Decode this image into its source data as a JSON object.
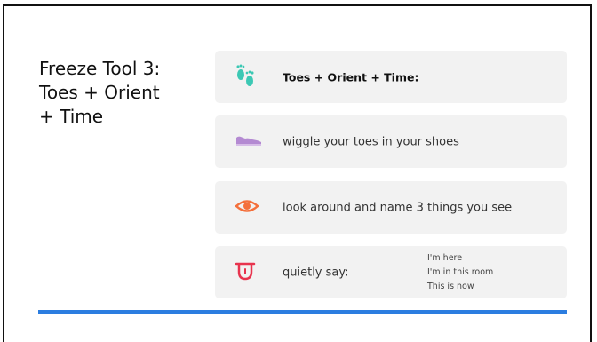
{
  "slide": {
    "title_lines": [
      "Freeze Tool 3:",
      "Toes + Orient",
      "+ Time"
    ],
    "cards": [
      {
        "icon": "footprints-icon",
        "text": "Toes + Orient + Time:",
        "color": "#3cc8b4"
      },
      {
        "icon": "shoe-icon",
        "text": "wiggle your toes in your shoes",
        "color": "#b48ad2"
      },
      {
        "icon": "eye-icon",
        "text": "look around and name 3 things you see",
        "color": "#f4703c"
      },
      {
        "icon": "tongue-icon",
        "text": "quietly say:",
        "color": "#e8344e"
      }
    ],
    "phrases": [
      "I'm here",
      "I'm in this room",
      "This is now"
    ],
    "accent_color": "#2b7de0"
  }
}
